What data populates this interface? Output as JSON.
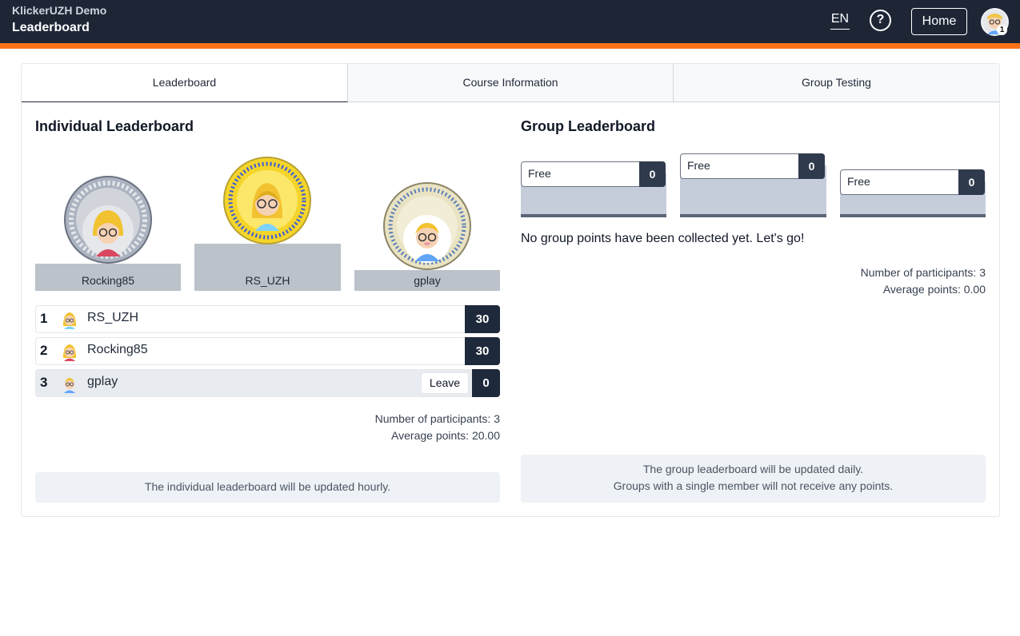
{
  "header": {
    "app_name": "KlickerUZH Demo",
    "page_title": "Leaderboard",
    "language": "EN",
    "help_icon": "?",
    "home_label": "Home",
    "profile_badge": "1"
  },
  "tabs": [
    {
      "label": "Leaderboard",
      "active": true
    },
    {
      "label": "Course Information",
      "active": false
    },
    {
      "label": "Group Testing",
      "active": false
    }
  ],
  "individual": {
    "title": "Individual Leaderboard",
    "podium": [
      {
        "place": 2,
        "name": "Rocking85",
        "medal": "silver"
      },
      {
        "place": 1,
        "name": "RS_UZH",
        "medal": "gold"
      },
      {
        "place": 3,
        "name": "gplay",
        "medal": "bronze"
      }
    ],
    "entries": [
      {
        "rank": "1",
        "name": "RS_UZH",
        "points": "30"
      },
      {
        "rank": "2",
        "name": "Rocking85",
        "points": "30"
      },
      {
        "rank": "3",
        "name": "gplay",
        "points": "0",
        "leave_label": "Leave"
      }
    ],
    "participants": "Number of participants: 3",
    "average": "Average points: 20.00",
    "info": "The individual leaderboard will be updated hourly."
  },
  "group": {
    "title": "Group Leaderboard",
    "podium": [
      {
        "name": "Free",
        "points": "0"
      },
      {
        "name": "Free",
        "points": "0"
      },
      {
        "name": "Free",
        "points": "0"
      }
    ],
    "empty_message": "No group points have been collected yet. Let's go!",
    "participants": "Number of participants: 3",
    "average": "Average points: 0.00",
    "info_line1": "The group leaderboard will be updated daily.",
    "info_line2": "Groups with a single member will not receive any points."
  },
  "colors": {
    "header_bg": "#1e2636",
    "accent": "#f97316",
    "points_bg": "#1e293b",
    "silver": "#aab3bf",
    "gold": "#f5d52a",
    "bronze": "#e9e3c3"
  }
}
